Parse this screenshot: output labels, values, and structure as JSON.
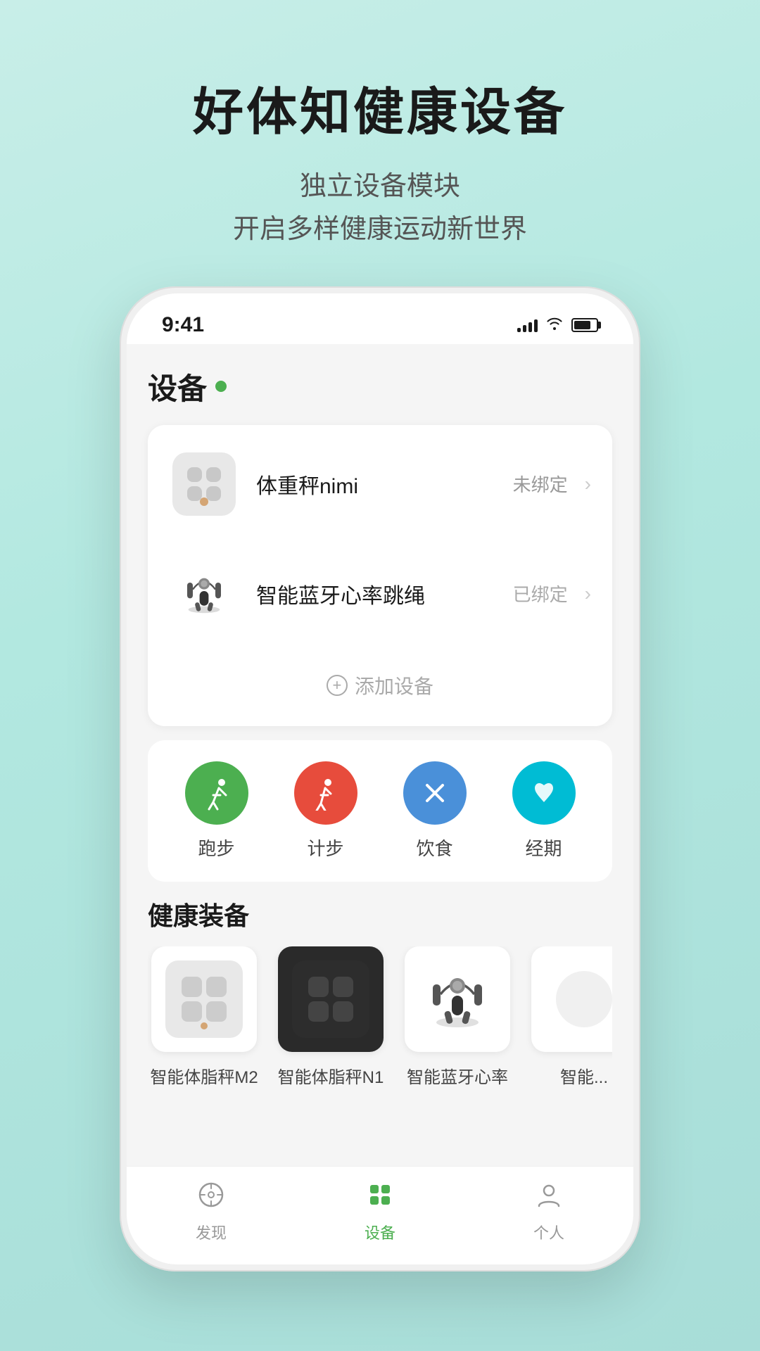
{
  "header": {
    "main_title": "好体知健康设备",
    "sub_title_line1": "独立设备模块",
    "sub_title_line2": "开启多样健康运动新世界"
  },
  "status_bar": {
    "time": "9:41"
  },
  "page": {
    "section_title": "设备",
    "devices": [
      {
        "name": "体重秤nimi",
        "status": "未绑定",
        "type": "scale_white"
      },
      {
        "name": "智能蓝牙心率跳绳",
        "status": "已绑定",
        "type": "rope"
      }
    ],
    "add_device_label": "添加设备",
    "quick_actions": [
      {
        "label": "跑步",
        "color": "#4CAF50",
        "icon": "🏃"
      },
      {
        "label": "计步",
        "color": "#e74c4c",
        "icon": "🚶"
      },
      {
        "label": "饮食",
        "color": "#5b9bd5",
        "icon": "✕"
      },
      {
        "label": "经期",
        "color": "#00bcd4",
        "icon": "♀"
      }
    ],
    "health_section_title": "健康装备",
    "equipment": [
      {
        "name": "智能体脂秤M2",
        "type": "scale_white"
      },
      {
        "name": "智能体脂秤N1",
        "type": "scale_dark"
      },
      {
        "name": "智能蓝牙心率",
        "type": "rope_sm"
      },
      {
        "name": "智能...",
        "type": "other"
      }
    ],
    "bottom_nav": [
      {
        "label": "发现",
        "active": false,
        "icon": "discover"
      },
      {
        "label": "设备",
        "active": true,
        "icon": "device"
      },
      {
        "label": "个人",
        "active": false,
        "icon": "person"
      }
    ]
  }
}
